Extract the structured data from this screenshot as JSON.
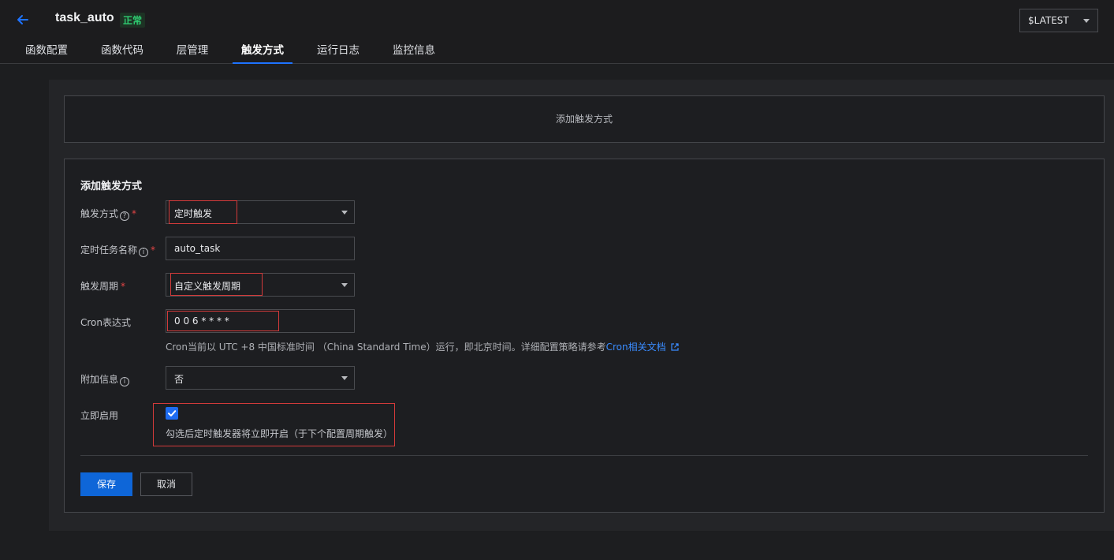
{
  "header": {
    "title": "task_auto",
    "status": "正常",
    "version": "$LATEST"
  },
  "tabs": [
    {
      "label": "函数配置"
    },
    {
      "label": "函数代码"
    },
    {
      "label": "层管理"
    },
    {
      "label": "触发方式",
      "active": true
    },
    {
      "label": "运行日志"
    },
    {
      "label": "监控信息"
    }
  ],
  "add_trigger_box": {
    "label": "添加触发方式"
  },
  "form": {
    "title": "添加触发方式",
    "trigger_type": {
      "label": "触发方式",
      "value": "定时触发"
    },
    "task_name": {
      "label": "定时任务名称",
      "value": "auto_task"
    },
    "period": {
      "label": "触发周期",
      "value": "自定义触发周期"
    },
    "cron": {
      "label": "Cron表达式",
      "value": "0 0 6 * * * *"
    },
    "cron_hint": {
      "text": "Cron当前以 UTC +8 中国标准时间 （China Standard Time）运行，即北京时间。详细配置策略请参考",
      "link": "Cron相关文档"
    },
    "extra_info": {
      "label": "附加信息",
      "value": "否"
    },
    "enable_now": {
      "label": "立即启用",
      "checked": true,
      "hint": "勾选后定时触发器将立即开启（于下个配置周期触发）"
    },
    "save_label": "保存",
    "cancel_label": "取消"
  },
  "colors": {
    "accent": "#1e73ff",
    "status_green": "#2ecc71",
    "required": "#e54545",
    "highlight_box": "#d33a3a"
  }
}
